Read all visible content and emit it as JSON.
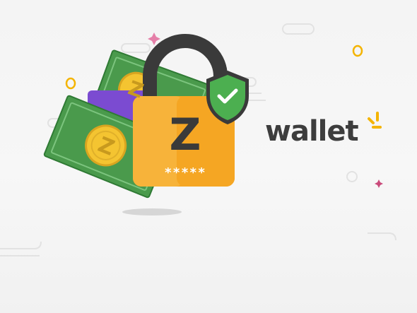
{
  "brand": {
    "wordmark": "wallet"
  },
  "lock": {
    "letter": "Z",
    "code": "*****"
  },
  "coin": {
    "letter": "Z"
  },
  "colors": {
    "lock_body": "#f5a623",
    "lock_shackle": "#3a3a3a",
    "shield": "#4caf50",
    "cash": "#4a9a4c",
    "coin": "#f4c431",
    "purple_wallet": "#7b4bd1",
    "accent_yellow": "#f4b400",
    "accent_pink": "#e57fa8"
  },
  "icons": [
    "padlock-icon",
    "shield-check-icon",
    "banknote-icon",
    "coin-icon",
    "sparkle-icon"
  ]
}
